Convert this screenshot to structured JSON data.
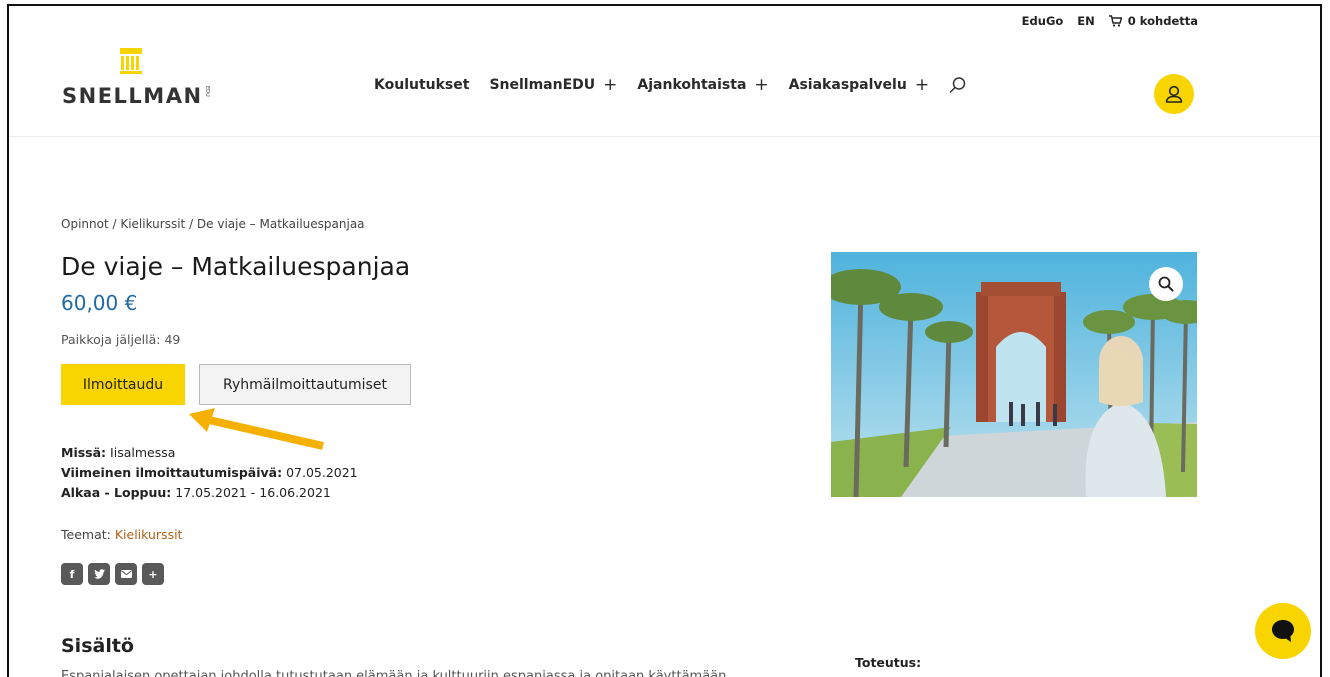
{
  "topbar": {
    "edugo": "EduGo",
    "lang": "EN",
    "cart": "0 kohdetta"
  },
  "logo": {
    "text": "SNELLMAN",
    "suffix": "EDU"
  },
  "nav": {
    "items": [
      {
        "label": "Koulutukset",
        "has_plus": false
      },
      {
        "label": "SnellmanEDU",
        "has_plus": true
      },
      {
        "label": "Ajankohtaista",
        "has_plus": true
      },
      {
        "label": "Asiakaspalvelu",
        "has_plus": true
      }
    ],
    "plus": "+"
  },
  "breadcrumb": {
    "items": [
      "Opinnot",
      "Kielikurssit",
      "De viaje – Matkailuespanjaa"
    ],
    "separator": " / "
  },
  "product": {
    "title": "De viaje – Matkailuespanjaa",
    "price": "60,00 €",
    "seats": "Paikkoja jäljellä: 49",
    "register_button": "Ilmoittaudu",
    "group_button": "Ryhmäilmoittautumiset",
    "where_label": "Missä:",
    "where_value": "Iisalmessa",
    "deadline_label": "Viimeinen ilmoittautumispäivä:",
    "deadline_value": "07.05.2021",
    "dates_label": "Alkaa - Loppuu:",
    "dates_value": "17.05.2021 - 16.06.2021",
    "themes_label": "Teemat:",
    "themes_link": "Kielikurssit"
  },
  "share": {
    "icons": [
      "facebook-icon",
      "twitter-icon",
      "email-icon",
      "more-icon"
    ],
    "glyphs": [
      "f",
      "t",
      "✉",
      "+"
    ]
  },
  "content": {
    "section_title": "Sisältö",
    "section_text": "Espanjalaisen opettajan johdolla tutustutaan elämään ja kulttuuriin espanjassa ja opitaan käyttämään",
    "toteutus_label": "Toteutus:"
  },
  "colors": {
    "accent": "#f8d400",
    "price": "#1f6aa6",
    "link": "#b0611a",
    "arrow": "#f5b000"
  }
}
